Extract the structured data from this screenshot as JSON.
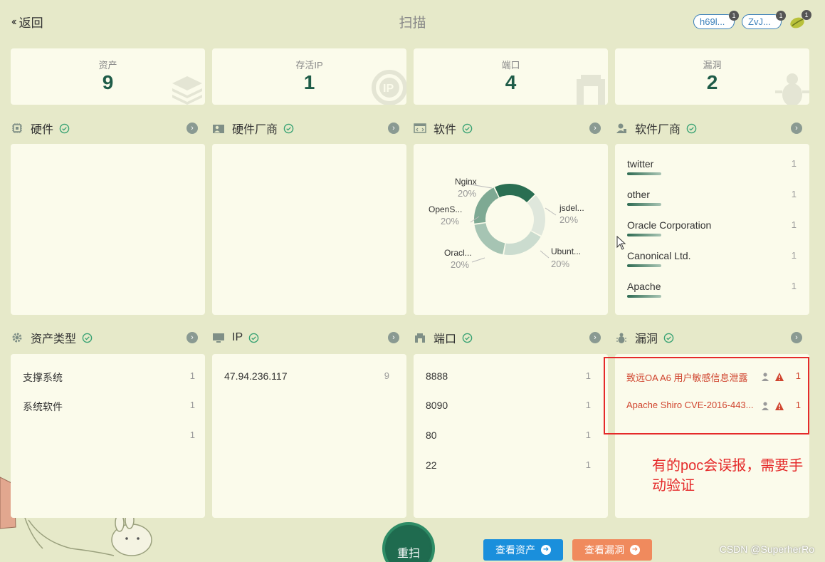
{
  "header": {
    "back_label": "返回",
    "title": "扫描",
    "pills": [
      {
        "label": "h69l...",
        "badge": "1"
      },
      {
        "label": "ZvJ...",
        "badge": "1"
      }
    ],
    "leaf_badge": "1"
  },
  "stats": [
    {
      "label": "资产",
      "value": "9",
      "icon": "layers-icon"
    },
    {
      "label": "存活IP",
      "value": "1",
      "icon": "ip-icon"
    },
    {
      "label": "端口",
      "value": "4",
      "icon": "port-icon"
    },
    {
      "label": "漏洞",
      "value": "2",
      "icon": "bug-icon"
    }
  ],
  "sections": {
    "hardware": {
      "title": "硬件"
    },
    "hardware_vendor": {
      "title": "硬件厂商"
    },
    "software": {
      "title": "软件",
      "chart_data": {
        "type": "pie",
        "donut": true,
        "labels": [
          "Nginx",
          "jsdel...",
          "Ubunt...",
          "Oracl...",
          "OpenS..."
        ],
        "values": [
          20,
          20,
          20,
          20,
          20
        ],
        "percent_labels": [
          "20%",
          "20%",
          "20%",
          "20%",
          "20%"
        ],
        "colors": [
          "#2a6e52",
          "#dfe7dc",
          "#cbdccf",
          "#a6c4b3",
          "#7ea993"
        ]
      }
    },
    "software_vendor": {
      "title": "软件厂商",
      "items": [
        {
          "name": "twitter",
          "count": "1"
        },
        {
          "name": "other",
          "count": "1"
        },
        {
          "name": "Oracle Corporation",
          "count": "1"
        },
        {
          "name": "Canonical Ltd.",
          "count": "1"
        },
        {
          "name": "Apache",
          "count": "1"
        }
      ]
    },
    "asset_type": {
      "title": "资产类型",
      "items": [
        {
          "name": "支撑系统",
          "count": "1"
        },
        {
          "name": "系统软件",
          "count": "1"
        },
        {
          "name": "",
          "count": "1"
        }
      ]
    },
    "ip": {
      "title": "IP",
      "items": [
        {
          "name": "47.94.236.117",
          "count": "9"
        }
      ]
    },
    "port": {
      "title": "端口",
      "items": [
        {
          "name": "8888",
          "count": "1"
        },
        {
          "name": "8090",
          "count": "1"
        },
        {
          "name": "80",
          "count": "1"
        },
        {
          "name": "22",
          "count": "1"
        }
      ]
    },
    "vuln": {
      "title": "漏洞",
      "items": [
        {
          "name": "致远OA A6 用户敏感信息泄露",
          "count": "1"
        },
        {
          "name": "Apache Shiro CVE-2016-443...",
          "count": "1"
        }
      ]
    }
  },
  "annotation": {
    "line1": "有的poc会误报，需要手",
    "line2": "动验证"
  },
  "buttons": {
    "rescan": "重扫",
    "view_assets": "查看资产",
    "view_vulns": "查看漏洞"
  },
  "watermark": "CSDN @SuperherRo",
  "colors": {
    "accent": "#1f5c48",
    "vuln_red": "#d0452f",
    "blue_btn": "#1a8fdc",
    "orange_btn": "#f08a5d"
  }
}
